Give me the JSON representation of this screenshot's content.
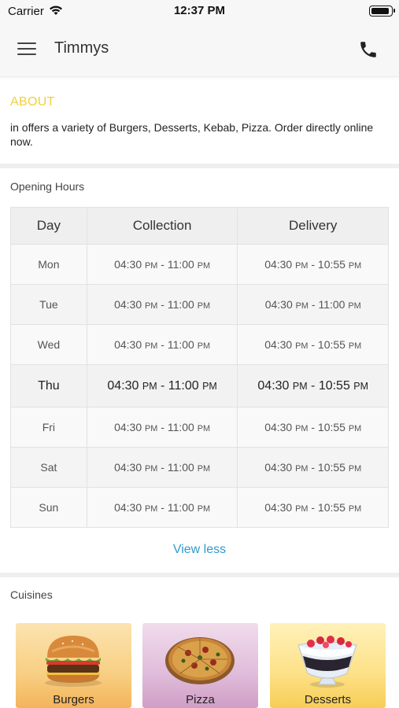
{
  "status_bar": {
    "carrier": "Carrier",
    "time": "12:37 PM"
  },
  "nav": {
    "title": "Timmys",
    "menu_icon": "hamburger-menu-icon",
    "phone_icon": "phone-icon"
  },
  "about": {
    "heading": "ABOUT",
    "text": "in  offers a variety of Burgers, Desserts, Kebab, Pizza. Order directly online now."
  },
  "hours": {
    "title": "Opening Hours",
    "headers": [
      "Day",
      "Collection",
      "Delivery"
    ],
    "rows": [
      {
        "day": "Mon",
        "collection": "04:30 PM - 11:00 PM",
        "delivery": "04:30 PM - 10:55 PM"
      },
      {
        "day": "Tue",
        "collection": "04:30 PM - 11:00 PM",
        "delivery": "04:30 PM - 11:00 PM"
      },
      {
        "day": "Wed",
        "collection": "04:30 PM - 11:00 PM",
        "delivery": "04:30 PM - 10:55 PM"
      },
      {
        "day": "Thu",
        "collection": "04:30 PM - 11:00 PM",
        "delivery": "04:30 PM - 10:55 PM"
      },
      {
        "day": "Fri",
        "collection": "04:30 PM - 11:00 PM",
        "delivery": "04:30 PM - 10:55 PM"
      },
      {
        "day": "Sat",
        "collection": "04:30 PM - 11:00 PM",
        "delivery": "04:30 PM - 10:55 PM"
      },
      {
        "day": "Sun",
        "collection": "04:30 PM - 11:00 PM",
        "delivery": "04:30 PM - 10:55 PM"
      }
    ],
    "today": "Thu",
    "view_less": "View less"
  },
  "cuisines": {
    "title": "Cuisines",
    "items": [
      {
        "label": "Burgers",
        "icon": "burger-icon"
      },
      {
        "label": "Pizza",
        "icon": "pizza-icon"
      },
      {
        "label": "Desserts",
        "icon": "dessert-icon"
      }
    ]
  },
  "colors": {
    "accent": "#f2cf3a",
    "link": "#2f9ad0"
  }
}
